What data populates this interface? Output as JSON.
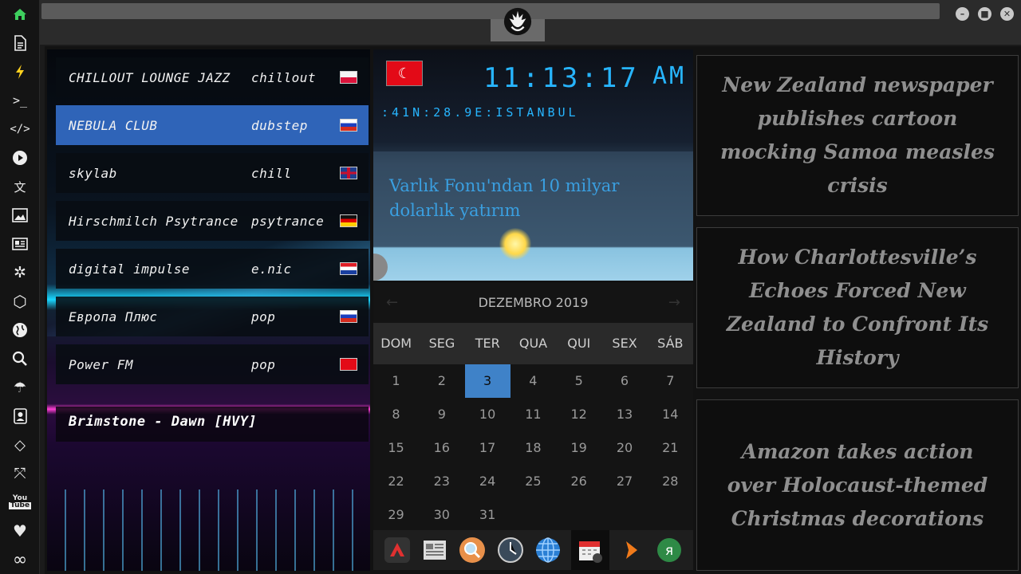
{
  "sidebar": {
    "icons": [
      "home-icon",
      "document-icon",
      "lightning-icon",
      "terminal-icon",
      "code-icon",
      "play-icon",
      "translate-icon",
      "image-icon",
      "newspaper-icon",
      "settings-wheel-icon",
      "hexagon-icon",
      "globe-icon",
      "search-icon",
      "umbrella-icon",
      "contact-icon",
      "tag-icon",
      "fullscreen-icon",
      "youtube-icon",
      "heart-icon",
      "infinity-icon"
    ]
  },
  "window": {
    "controls": [
      "minimize",
      "maximize",
      "close"
    ]
  },
  "radio": {
    "stations": [
      {
        "name": "CHILLOUT LOUNGE JAZZ",
        "genre": "chillout",
        "flag": "poland"
      },
      {
        "name": "NEBULA CLUB",
        "genre": "dubstep",
        "flag": "russia"
      },
      {
        "name": "skylab",
        "genre": "chill",
        "flag": "united-kingdom"
      },
      {
        "name": "Hirschmilch Psytrance",
        "genre": "psytrance",
        "flag": "germany"
      },
      {
        "name": "digital impulse",
        "genre": "e.nic",
        "flag": "croatia"
      },
      {
        "name": "Европа Плюс",
        "genre": "pop",
        "flag": "russia"
      },
      {
        "name": "Power FM",
        "genre": "pop",
        "flag": "turkey"
      }
    ],
    "now_playing": "Brimstone - Dawn [HVY]"
  },
  "clock": {
    "time": "11:13:17",
    "ampm": "AM",
    "location": ":41N:28.9E:ISTANBUL",
    "headline": "Varlık Fonu'ndan 10 milyar dolarlık yatırım"
  },
  "calendar": {
    "month": "DEZEMBRO 2019",
    "prev": "←",
    "next": "→",
    "weekdays": [
      "DOM",
      "SEG",
      "TER",
      "QUA",
      "QUI",
      "SEX",
      "SÁB"
    ],
    "days": [
      "1",
      "2",
      "3",
      "4",
      "5",
      "6",
      "7",
      "8",
      "9",
      "10",
      "11",
      "12",
      "13",
      "14",
      "15",
      "16",
      "17",
      "18",
      "19",
      "20",
      "21",
      "22",
      "23",
      "24",
      "25",
      "26",
      "27",
      "28",
      "29",
      "30",
      "31"
    ],
    "today": "3"
  },
  "dock": {
    "apps": [
      "vivaldi-icon",
      "news-app-icon",
      "search-app-icon",
      "clock-app-icon",
      "browser-globe-icon",
      "calendar-app-icon",
      "arrow-app-icon",
      "yandex-icon"
    ]
  },
  "news": {
    "stories": [
      "New Zealand newspaper publishes cartoon mocking Samoa measles crisis",
      "How Charlottesville’s Echoes Forced New Zealand to Confront Its History",
      "Amazon takes action over Holocaust-themed Christmas decorations"
    ]
  },
  "colors": {
    "accent": "#27b5ff",
    "selected_row": "#2f64b8",
    "today": "#3f82c8"
  }
}
